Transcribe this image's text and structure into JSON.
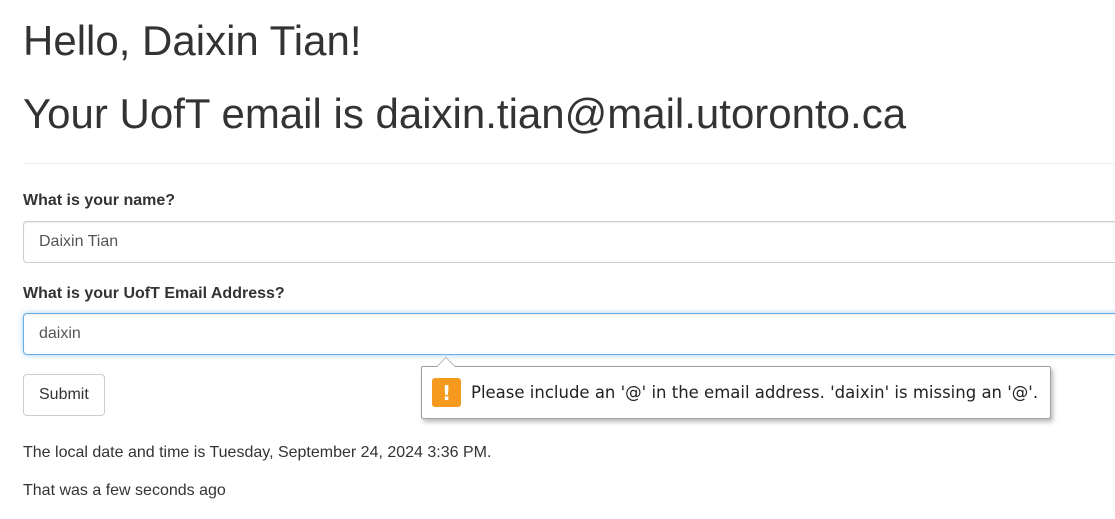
{
  "header": {
    "greeting": "Hello, Daixin Tian!",
    "email_heading": "Your UofT email is daixin.tian@mail.utoronto.ca"
  },
  "form": {
    "name_label": "What is your name?",
    "name_value": "Daixin Tian",
    "email_label": "What is your UofT Email Address?",
    "email_value": "daixin",
    "submit_label": "Submit"
  },
  "validation": {
    "icon": "warning-exclamation-icon",
    "icon_color": "#f59a1e",
    "message": "Please include an '@' in the email address. 'daixin' is missing an '@'."
  },
  "footer": {
    "datetime_text": "The local date and time is Tuesday, September 24, 2024 3:36 PM.",
    "relative_time_text": "That was a few seconds ago"
  },
  "colors": {
    "focus_border": "#66afe9",
    "text": "#333333"
  }
}
